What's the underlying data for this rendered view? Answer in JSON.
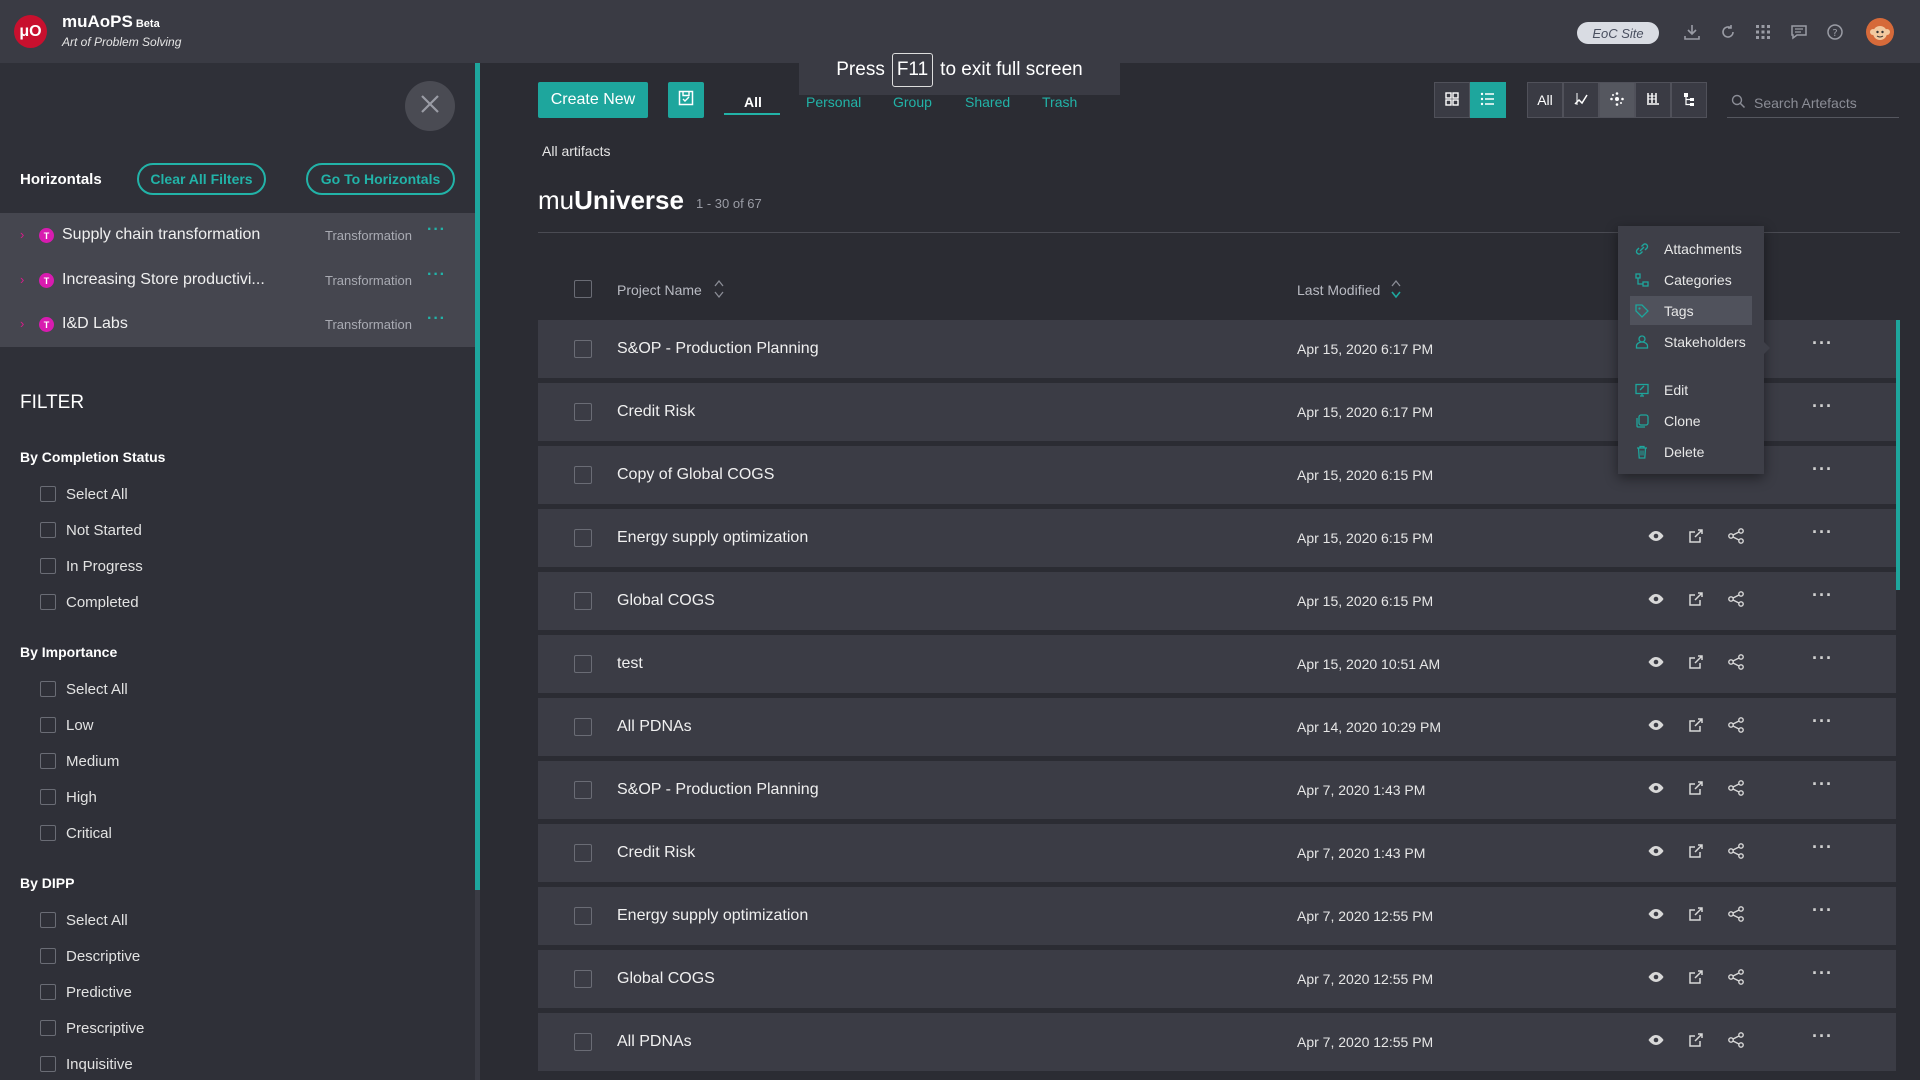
{
  "app": {
    "logo_text": "μO",
    "name": "muAoPS",
    "beta": "Beta",
    "tagline": "Art of Problem Solving",
    "site_badge": "EoC Site"
  },
  "topbar_icons": [
    "download-icon",
    "refresh-icon",
    "apps-grid-icon",
    "chat-icon",
    "help-icon",
    "avatar"
  ],
  "sidebar": {
    "horizontals_label": "Horizontals",
    "clear_filters": "Clear All Filters",
    "go_horizontals": "Go To Horizontals",
    "horizontals": [
      {
        "name": "Supply chain transformation",
        "badge": "T",
        "type": "Transformation"
      },
      {
        "name": "Increasing Store productivi...",
        "badge": "T",
        "type": "Transformation"
      },
      {
        "name": "I&D Labs",
        "badge": "T",
        "type": "Transformation"
      }
    ],
    "filter_title": "FILTER",
    "groups": [
      {
        "title": "By Completion Status",
        "options": [
          "Select All",
          "Not Started",
          "In Progress",
          "Completed"
        ]
      },
      {
        "title": "By Importance",
        "options": [
          "Select All",
          "Low",
          "Medium",
          "High",
          "Critical"
        ]
      },
      {
        "title": "By DIPP",
        "options": [
          "Select All",
          "Descriptive",
          "Predictive",
          "Prescriptive",
          "Inquisitive"
        ]
      }
    ]
  },
  "toolbar": {
    "create_new": "Create New",
    "tabs": [
      "All",
      "Personal",
      "Group",
      "Shared",
      "Trash"
    ],
    "active_tab": "All",
    "fullscreen_press": "Press",
    "fullscreen_key": "F11",
    "fullscreen_rest": "to exit full screen",
    "filter_all": "All",
    "search_placeholder": "Search Artefacts"
  },
  "page": {
    "breadcrumb": "All artifacts",
    "title_prefix": "mu",
    "title_bold": "Universe",
    "count": "1 - 30 of 67",
    "col_project": "Project Name",
    "col_modified": "Last Modified"
  },
  "rows": [
    {
      "name": "S&OP - Production Planning",
      "date": "Apr 15, 2020 6:17 PM"
    },
    {
      "name": "Credit Risk",
      "date": "Apr 15, 2020 6:17 PM"
    },
    {
      "name": "Copy of Global COGS",
      "date": "Apr 15, 2020 6:15 PM"
    },
    {
      "name": "Energy supply optimization",
      "date": "Apr 15, 2020 6:15 PM"
    },
    {
      "name": "Global COGS",
      "date": "Apr 15, 2020 6:15 PM"
    },
    {
      "name": "test",
      "date": "Apr 15, 2020 10:51 AM"
    },
    {
      "name": "All PDNAs",
      "date": "Apr 14, 2020 10:29 PM"
    },
    {
      "name": "S&OP - Production Planning",
      "date": "Apr 7, 2020 1:43 PM"
    },
    {
      "name": "Credit Risk",
      "date": "Apr 7, 2020 1:43 PM"
    },
    {
      "name": "Energy supply optimization",
      "date": "Apr 7, 2020 12:55 PM"
    },
    {
      "name": "Global COGS",
      "date": "Apr 7, 2020 12:55 PM"
    },
    {
      "name": "All PDNAs",
      "date": "Apr 7, 2020 12:55 PM"
    }
  ],
  "context_menu": {
    "items": [
      "Attachments",
      "Categories",
      "Tags",
      "Stakeholders",
      "Edit",
      "Clone",
      "Delete"
    ],
    "highlighted": "Tags"
  },
  "colors": {
    "accent": "#1ea69d",
    "badge": "#d81bb0",
    "background": "#2b2c33"
  }
}
